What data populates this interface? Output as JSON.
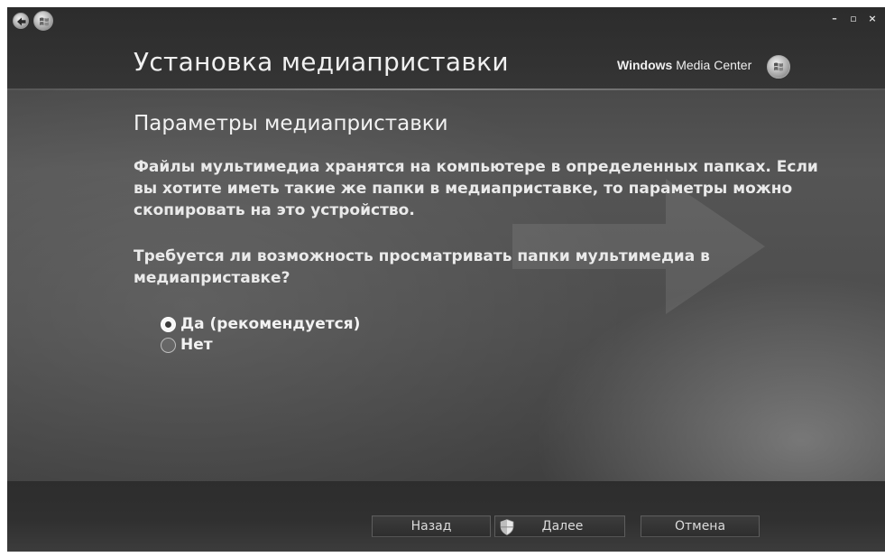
{
  "app": {
    "page_title": "Установка медиаприставки",
    "brand_windows": "Windows",
    "brand_suffix": " Media Center",
    "window_controls": {
      "minimize": "–",
      "restore": "▫",
      "close": "×"
    }
  },
  "content": {
    "heading": "Параметры медиаприставки",
    "description": "Файлы мультимедиа хранятся на компьютере в определенных папках. Если вы хотите иметь такие же папки в медиаприставке, то параметры можно скопировать на это устройство.",
    "question": "Требуется ли возможность просматривать папки мультимедиа в медиаприставке?",
    "options": [
      {
        "label": "Да (рекомендуется)",
        "selected": true
      },
      {
        "label": "Нет",
        "selected": false
      }
    ]
  },
  "footer": {
    "back_label": "Назад",
    "next_label": "Далее",
    "cancel_label": "Отмена"
  },
  "icons": {
    "back": "back-arrow-icon",
    "start": "windows-logo-icon",
    "brand_logo": "media-center-logo-icon",
    "shield": "uac-shield-icon"
  }
}
